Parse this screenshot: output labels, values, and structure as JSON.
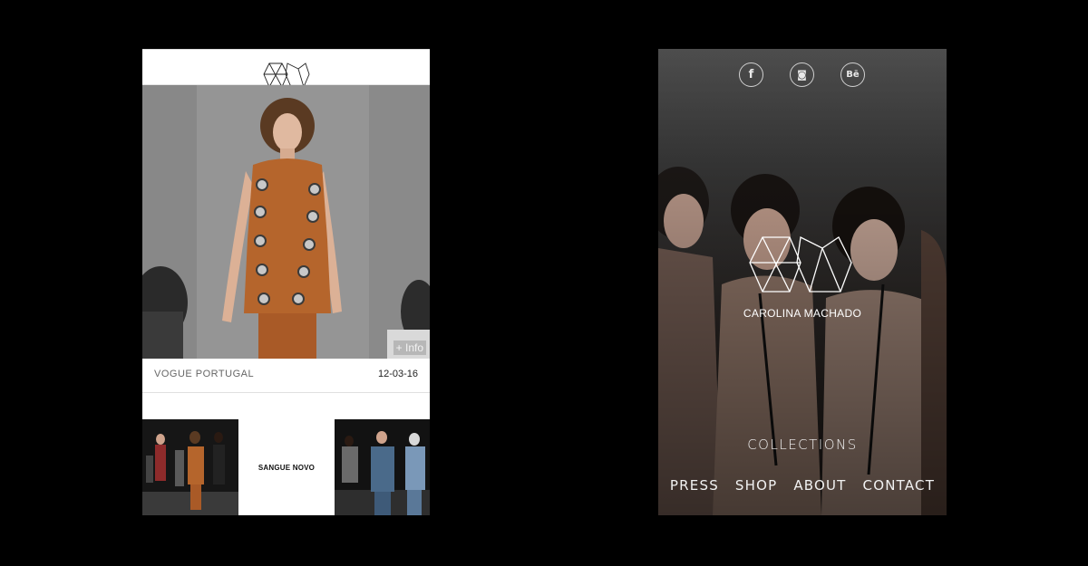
{
  "left_screen": {
    "hero": {
      "info_label": "+ Info"
    },
    "caption": {
      "source": "VOGUE PORTUGAL",
      "date": "12-03-16"
    },
    "tiles": {
      "middle_label": "SANGUE NOVO"
    }
  },
  "right_screen": {
    "social": {
      "facebook": "f",
      "instagram": "◙",
      "behance": "Bē"
    },
    "brand_name": "CAROLINA MACHADO",
    "menu": {
      "collections": "COLLECTIONS",
      "press": "PRESS",
      "shop": "SHOP",
      "about": "ABOUT",
      "contact": "CONTACT"
    }
  },
  "colors": {
    "background": "#000000",
    "dress": "#b5652c",
    "text_light": "#f2f2f2"
  }
}
